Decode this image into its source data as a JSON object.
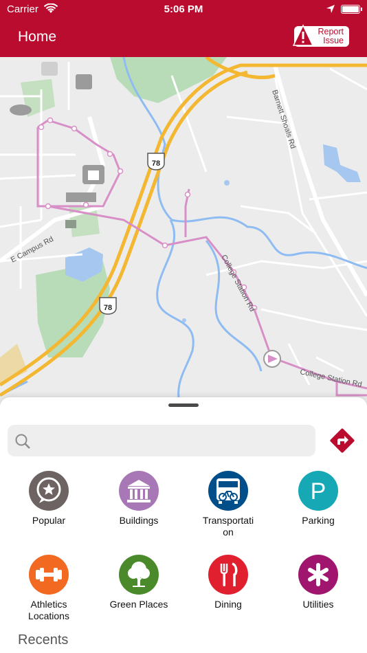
{
  "status_bar": {
    "carrier": "Carrier",
    "time": "5:06 PM",
    "icons": [
      "wifi-icon",
      "location-arrow-icon",
      "battery-icon"
    ]
  },
  "nav": {
    "title": "Home",
    "report_line1": "Report",
    "report_line2": "Issue",
    "color": "#ba0c2f"
  },
  "map": {
    "labels": {
      "road_barnett": "Barnett Shoals Rd",
      "road_campus": "E Campus Rd",
      "road_college_station": "College Station Rd",
      "road_college_station_2": "College Station Rd",
      "shield_78_top": "78",
      "shield_78_bottom": "78"
    }
  },
  "search": {
    "placeholder": "",
    "value": ""
  },
  "categories": [
    {
      "label": "Popular",
      "icon": "star-speech-bubble-icon",
      "color": "#6d6363"
    },
    {
      "label": "Buildings",
      "icon": "columns-building-icon",
      "color": "#a877b5"
    },
    {
      "label": "Transportati\non",
      "icon": "bus-bike-icon",
      "color": "#004e8a"
    },
    {
      "label": "Parking",
      "icon": "parking-p-icon",
      "color": "#17a8b5"
    },
    {
      "label": "Athletics\nLocations",
      "icon": "dumbbell-icon",
      "color": "#f26a21"
    },
    {
      "label": "Green Places",
      "icon": "tree-icon",
      "color": "#4a8a2a"
    },
    {
      "label": "Dining",
      "icon": "fork-knife-icon",
      "color": "#e0202e"
    },
    {
      "label": "Utilities",
      "icon": "asterisk-icon",
      "color": "#a0166f"
    }
  ],
  "recents_title": "Recents"
}
